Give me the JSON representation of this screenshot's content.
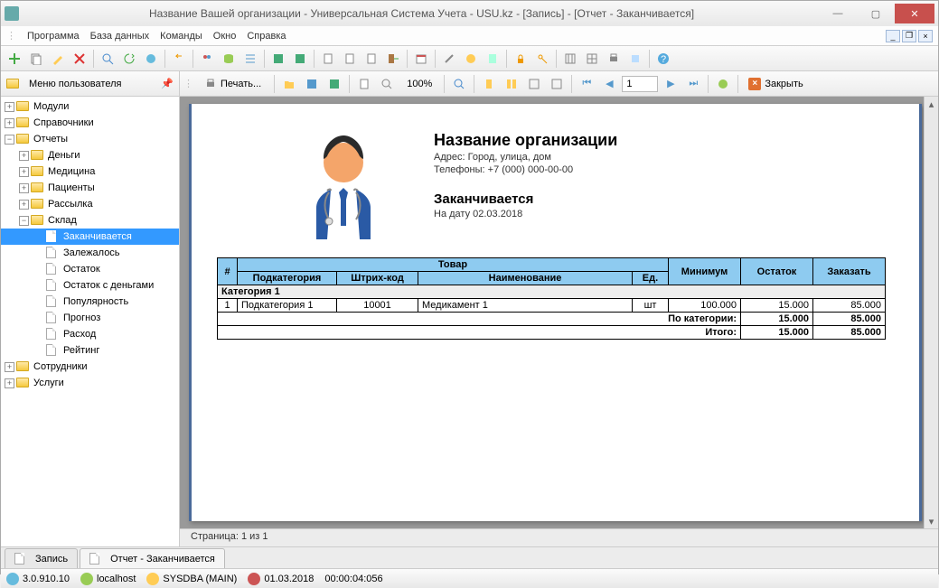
{
  "window": {
    "title": "Название Вашей организации - Универсальная Система Учета - USU.kz - [Запись] - [Отчет - Заканчивается]"
  },
  "menu": {
    "program": "Программа",
    "database": "База данных",
    "commands": "Команды",
    "window": "Окно",
    "help": "Справка"
  },
  "toolbar2": {
    "print": "Печать...",
    "zoom": "100%",
    "page": "1",
    "close": "Закрыть"
  },
  "sidebar": {
    "title": "Меню пользователя",
    "nodes": {
      "modules": "Модули",
      "references": "Справочники",
      "reports": "Отчеты",
      "money": "Деньги",
      "medicine": "Медицина",
      "patients": "Пациенты",
      "mailing": "Рассылка",
      "warehouse": "Склад",
      "ending": "Заканчивается",
      "stale": "Залежалось",
      "balance": "Остаток",
      "balance_money": "Остаток с деньгами",
      "popularity": "Популярность",
      "forecast": "Прогноз",
      "expense": "Расход",
      "rating": "Рейтинг",
      "employees": "Сотрудники",
      "services": "Услуги"
    }
  },
  "report": {
    "org": "Название организации",
    "address": "Адрес: Город, улица, дом",
    "phones": "Телефоны: +7 (000) 000-00-00",
    "title": "Заканчивается",
    "date": "На дату 02.03.2018",
    "cols": {
      "num": "#",
      "product": "Товар",
      "subcat": "Подкатегория",
      "barcode": "Штрих-код",
      "name": "Наименование",
      "unit": "Ед.",
      "min": "Минимум",
      "balance": "Остаток",
      "order": "Заказать"
    },
    "cat1": "Категория 1",
    "row1": {
      "n": "1",
      "subcat": "Подкатегория 1",
      "barcode": "10001",
      "name": "Медикамент 1",
      "unit": "шт",
      "min": "100.000",
      "bal": "15.000",
      "ord": "85.000"
    },
    "bycat": "По категории:",
    "bycat_bal": "15.000",
    "bycat_ord": "85.000",
    "total": "Итого:",
    "total_bal": "15.000",
    "total_ord": "85.000",
    "pageinfo": "Страница: 1 из 1"
  },
  "tabs": {
    "tab1": "Запись",
    "tab2": "Отчет - Заканчивается"
  },
  "status": {
    "version": "3.0.910.10",
    "host": "localhost",
    "user": "SYSDBA (MAIN)",
    "date": "01.03.2018",
    "time": "00:00:04:056"
  },
  "chart_data": {
    "type": "table",
    "title": "Заканчивается",
    "columns": [
      "#",
      "Подкатегория",
      "Штрих-код",
      "Наименование",
      "Ед.",
      "Минимум",
      "Остаток",
      "Заказать"
    ],
    "rows": [
      {
        "category": "Категория 1",
        "n": 1,
        "subcat": "Подкатегория 1",
        "barcode": "10001",
        "name": "Медикамент 1",
        "unit": "шт",
        "min": 100.0,
        "balance": 15.0,
        "order": 85.0
      }
    ],
    "subtotals": [
      {
        "label": "По категории:",
        "balance": 15.0,
        "order": 85.0
      }
    ],
    "totals": {
      "label": "Итого:",
      "balance": 15.0,
      "order": 85.0
    }
  }
}
